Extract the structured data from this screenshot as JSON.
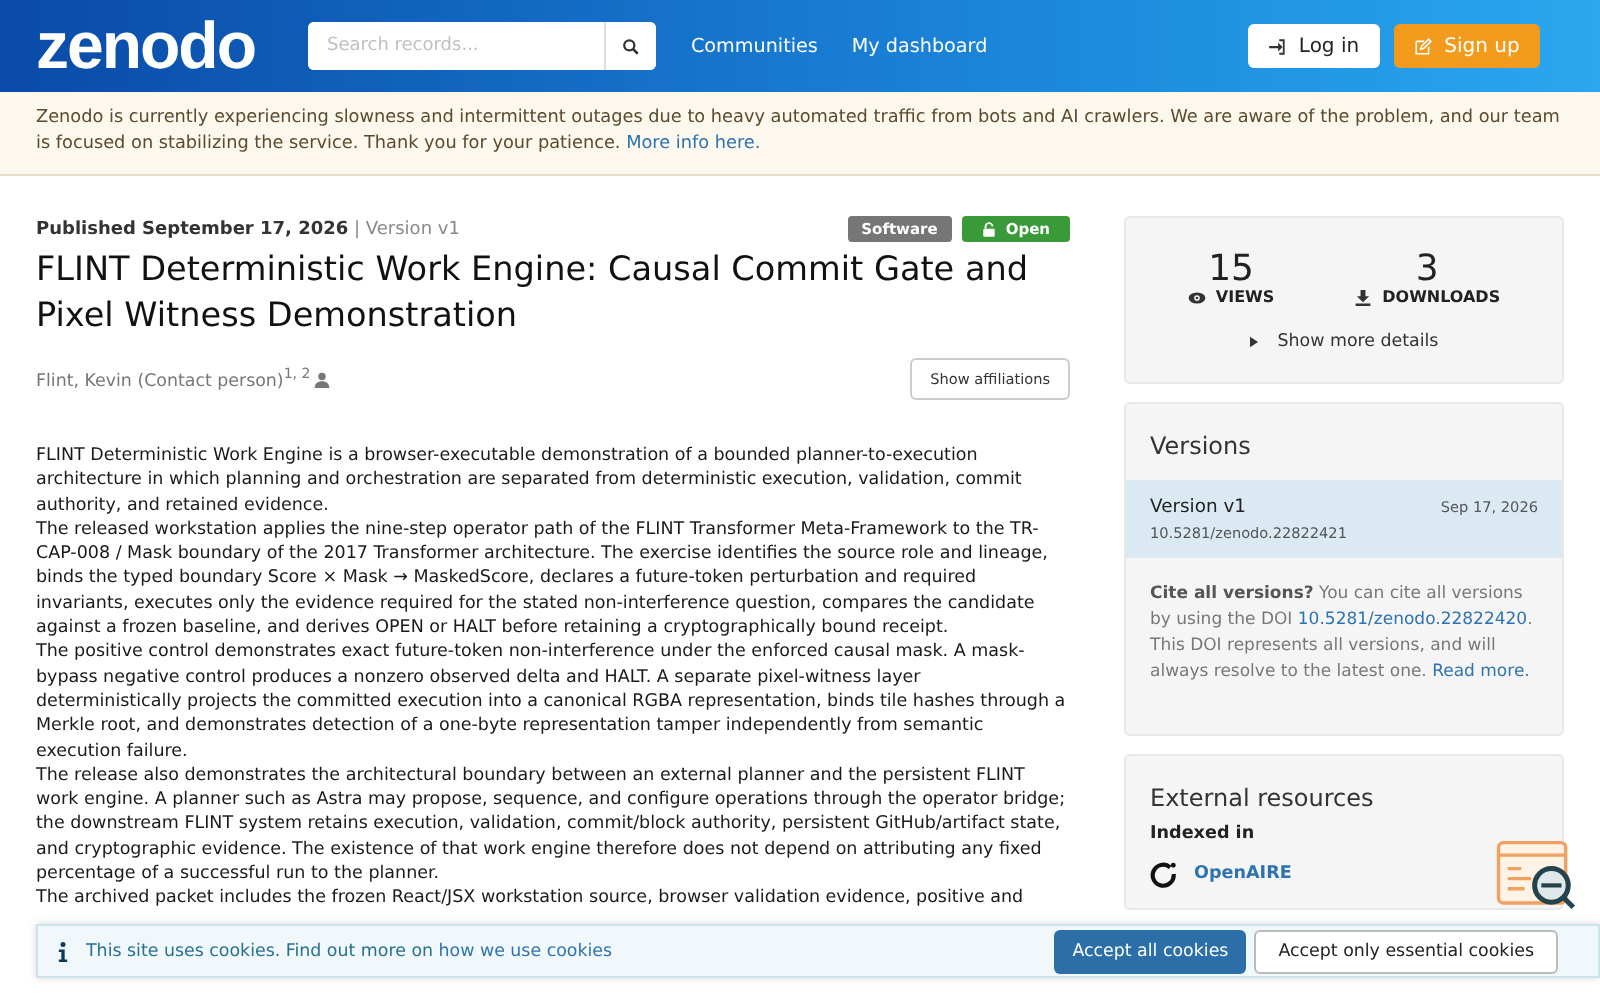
{
  "header": {
    "logo": "zenodo",
    "search": {
      "placeholder": "Search records..."
    },
    "nav": [
      "Communities",
      "My dashboard"
    ],
    "login": "Log in",
    "signup": "Sign up"
  },
  "banner": {
    "text": "Zenodo is currently experiencing slowness and intermittent outages due to heavy automated traffic from bots and AI crawlers. We are aware of the problem, and our team is focused on stabilizing the service. Thank you for your patience. ",
    "link": "More info here."
  },
  "record": {
    "published": "**Published September 17, 2026**",
    "separator": "|",
    "version": "Version v1",
    "badges": [
      {
        "label": "Software",
        "kind": "type"
      },
      {
        "label": "Open",
        "kind": "access"
      }
    ],
    "title": "FLINT Deterministic Work Engine: Causal Commit Gate and Pixel Witness Demonstration",
    "creator": "Flint, Kevin (Contact person)$^{1, 2}$",
    "show_affiliations": "Show affiliations",
    "description": [
      "FLINT Deterministic Work Engine is a browser-executable demonstration of a bounded planner-to-execution architecture in which planning and orchestration are separated from deterministic execution, validation, commit authority, and retained evidence.",
      "The released workstation applies the nine-step operator path of the FLINT Transformer Meta-Framework to the TR-CAP-008 / Mask boundary of the 2017 Transformer architecture. The exercise identifies the source role and lineage, binds the typed boundary Score × Mask → MaskedScore, declares a future-token perturbation and required invariants, executes only the evidence required for the stated non-interference question, compares the candidate against a frozen baseline, and derives OPEN or HALT before retaining a cryptographically bound receipt.",
      "The positive control demonstrates exact future-token non-interference under the enforced causal mask. A mask-bypass negative control produces a nonzero observed delta and HALT. A separate pixel-witness layer deterministically projects the committed execution into a canonical RGBA representation, binds tile hashes through a Merkle root, and demonstrates detection of a one-byte representation tamper independently from semantic execution failure.",
      "The release also demonstrates the architectural boundary between an external planner and the persistent FLINT work engine. A planner such as Astra may propose, sequence, and configure operations through the operator bridge; the downstream FLINT system retains execution, validation, commit/block authority, persistent GitHub/artifact state, and cryptographic evidence. The existence of that work engine therefore does not depend on attributing any fixed percentage of a successful run to the planner.",
      "The archived packet includes the frozen React/JSX workstation source, browser validation evidence, positive and"
    ]
  },
  "sidebar": {
    "stats": [
      {
        "count": "15",
        "label": "VIEWS",
        "kind": "views"
      },
      {
        "count": "3",
        "label": "DOWNLOADS",
        "kind": "downloads"
      }
    ],
    "more_details": "Show more details",
    "versions": {
      "heading": "Versions",
      "items": [
        {
          "name": "Version v1",
          "date": "Sep 17, 2026",
          "doi": "10.5281/zenodo.22822421",
          "selected": true
        }
      ],
      "cite_lead": "**Cite all versions?** You can cite all versions by using the DOI ",
      "cite_doi": "10.5281/zenodo.22822420",
      "cite_middle": ". This DOI represents all versions, and will always resolve to the latest one. ",
      "cite_more": "Read more."
    },
    "external": {
      "heading": "External resources",
      "subheading": "Indexed in",
      "items": [
        "OpenAIRE"
      ]
    }
  },
  "cookies": {
    "text": "This site uses cookies. Find out more on ",
    "link": "how we use cookies",
    "accept_all": "Accept all cookies",
    "accept_essential": "Accept only essential cookies"
  }
}
